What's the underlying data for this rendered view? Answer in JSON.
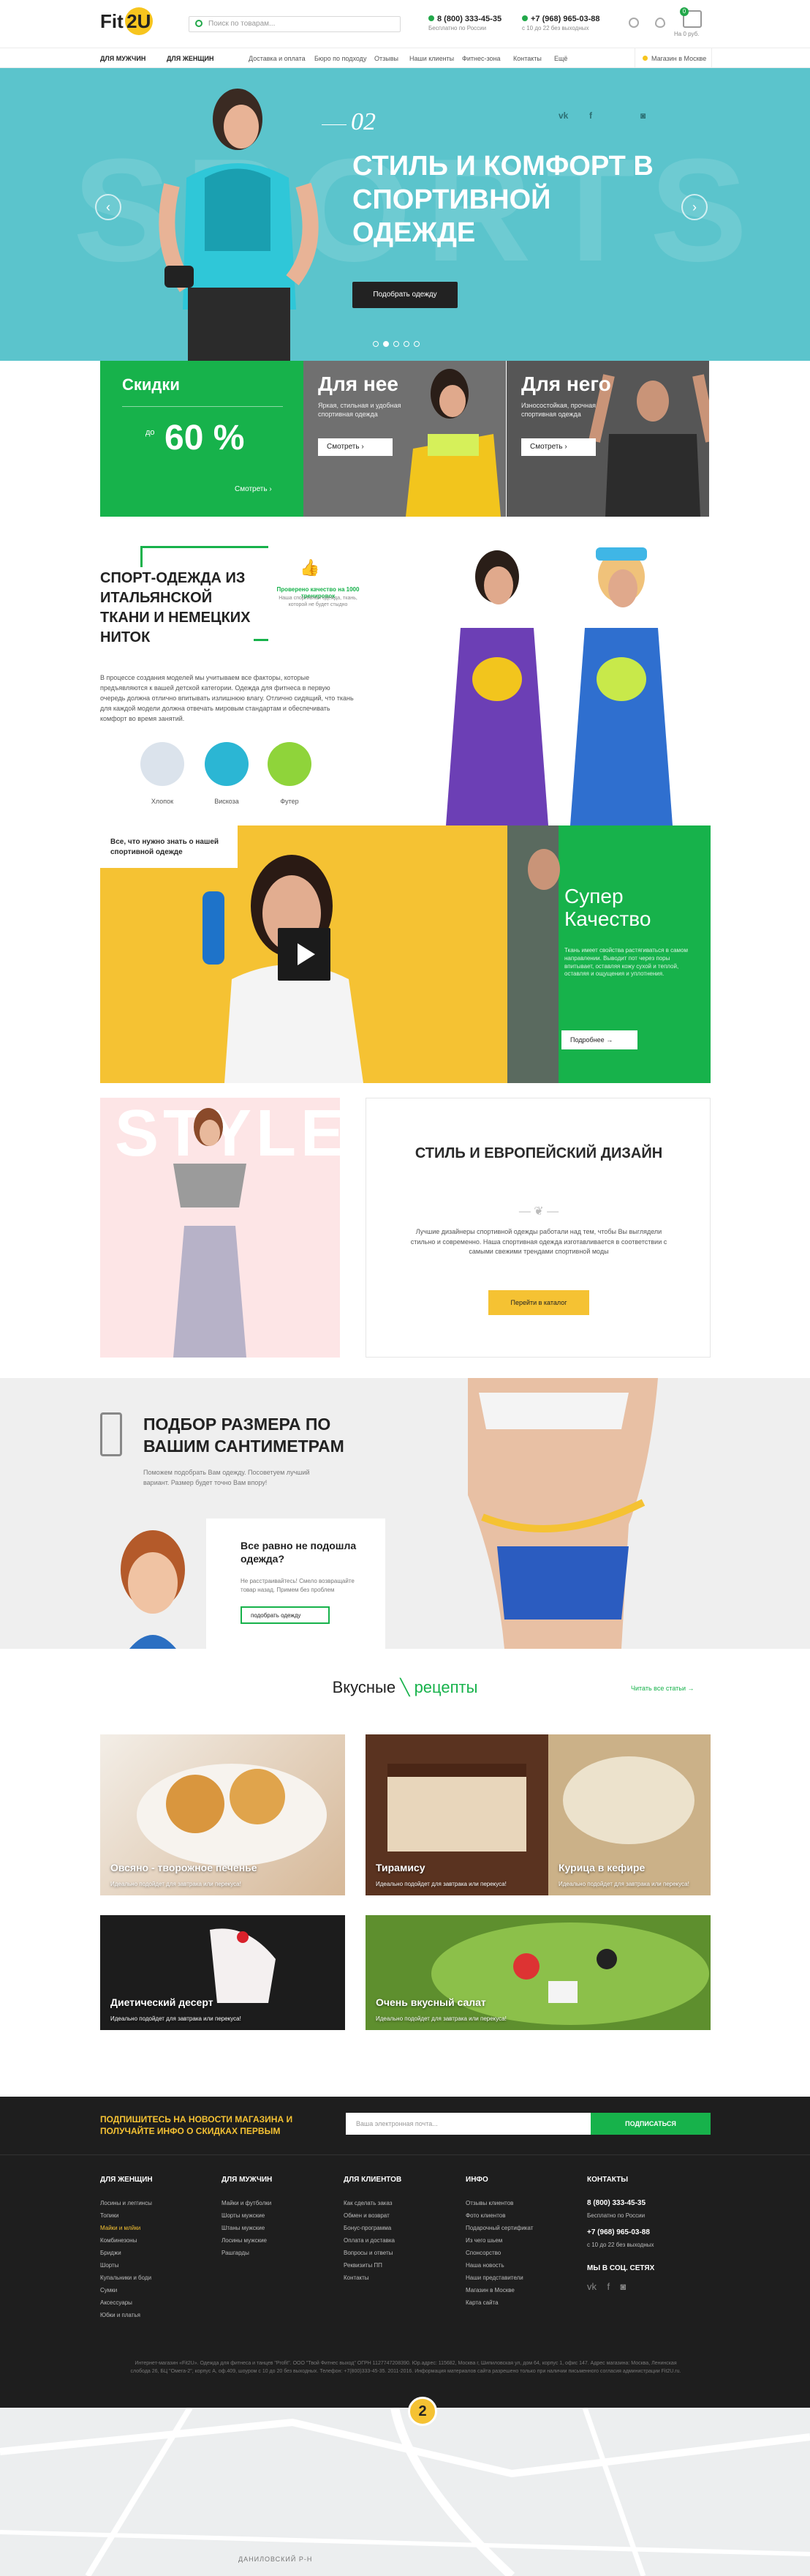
{
  "header": {
    "logo_text": "Fit",
    "logo_accent": "2U",
    "search_placeholder": "Поиск по товарам...",
    "phone1": "8 (800) 333-45-35",
    "phone1_note": "Бесплатно по России",
    "phone2": "+7 (968) 965-03-88",
    "phone2_note": "с 10 до 22 без выходных",
    "cart_count": "0",
    "cart_label": "На 0 руб."
  },
  "nav": {
    "items": [
      "ДЛЯ МУЖЧИН",
      "ДЛЯ ЖЕНЩИН",
      "Доставка и оплата",
      "Бюро по подходу",
      "Отзывы",
      "Наши клиенты",
      "Фитнес-зона",
      "Контакты",
      "Ещё"
    ],
    "city": "Магазин в Москве"
  },
  "hero": {
    "bg_word": "SPORTS",
    "slide_num": "02",
    "title": "СТИЛЬ И КОМФОРТ В СПОРТИВНОЙ ОДЕЖДЕ",
    "button": "Подобрать одежду",
    "social": [
      "vk",
      "f",
      "ig"
    ],
    "active_dot": 1,
    "dots": 5
  },
  "promo": {
    "sale_title": "Скидки",
    "sale_prefix": "до",
    "sale_value": "60 %",
    "sale_more": "Смотреть",
    "her_title": "Для нее",
    "her_text": "Яркая, стильная и удобная спортивная одежда",
    "her_btn": "Смотреть",
    "him_title": "Для него",
    "him_text": "Износостойкая, прочная спортивная одежда",
    "him_btn": "Смотреть"
  },
  "fabric": {
    "title": "СПОРТ-ОДЕЖДА ИЗ ИТАЛЬЯНСКОЙ ТКАНИ И НЕМЕЦКИХ НИТОК",
    "badge_label": "Проверено качество на 1000 тренировок",
    "badge_sub": "Наша спортивная одежда, ткань, которой не будет стыдно",
    "text": "В процессе создания моделей мы учитываем все факторы, которые предъявляются к вашей детской категории. Одежда для фитнеса в первую очередь должна отлично впитывать излишнюю влагу. Отлично сидящий, что ткань для каждой модели должна отвечать мировым стандартам и обеспечивать комфорт во время занятий.",
    "materials": [
      {
        "name": "Хлопок",
        "color": "#dbe3ec"
      },
      {
        "name": "Вискоза",
        "color": "#2bb6d4"
      },
      {
        "name": "Футер",
        "color": "#8fd43a"
      }
    ]
  },
  "video": {
    "note": "Все, что нужно знать о нашей спортивной одежде",
    "title": "Супер Качество",
    "text": "Ткань имеет свойства растягиваться в самом направлении. Выводит пот через поры впитывает, оставляя кожу сухой и теплой, оставляя и ощущения и уплотнения.",
    "button": "Подробнее"
  },
  "style": {
    "bg_word": "STYLE",
    "title": "СТИЛЬ И ЕВРОПЕЙСКИЙ ДИЗАЙН",
    "text": "Лучшие дизайнеры спортивной одежды работали над тем, чтобы Вы выглядели стильно и современно. Наша спортивная одежда изготавливается в соответствии с самыми свежими трендами спортивной моды",
    "button": "Перейти в каталог"
  },
  "size": {
    "title": "ПОДБОР РАЗМЕРА ПО ВАШИМ САНТИМЕТРАМ",
    "sub": "Поможем подобрать Вам одежду. Посоветуем лучший вариант. Размер будет точно Вам впору!",
    "card_title": "Все равно не подошла одежда?",
    "card_text": "Не расстраивайтесь! Смело возвращайте товар назад. Примем без проблем",
    "card_btn": "подобрать одежду"
  },
  "recipes": {
    "title_a": "Вкусные",
    "title_b": "рецепты",
    "all": "Читать все статьи",
    "items": [
      {
        "title": "Овсяно - творожное печенье",
        "desc": "Идеально подойдет для завтрака или перекуса!"
      },
      {
        "title": "Тирамису",
        "desc": "Идеально подойдет для завтрака или перекуса!"
      },
      {
        "title": "Курица в кефире",
        "desc": "Идеально подойдет для завтрака или перекуса!"
      },
      {
        "title": "Диетический десерт",
        "desc": "Идеально подойдет для завтрака или перекуса!"
      },
      {
        "title": "Очень вкусный салат",
        "desc": "Идеально подойдет для завтрака или перекуса!"
      }
    ]
  },
  "footer": {
    "sub_title": "ПОДПИШИТЕСЬ НА НОВОСТИ МАГАЗИНА И ПОЛУЧАЙТЕ ИНФО О СКИДКАХ ПЕРВЫМ",
    "sub_placeholder": "Ваша электронная почта...",
    "sub_btn": "ПОДПИСАТЬСЯ",
    "col1_title": "ДЛЯ ЖЕНЩИН",
    "col1": [
      "Лосины и леггинсы",
      "Топики",
      "Майки и млйки",
      "Комбинезоны",
      "Бриджи",
      "Шорты",
      "Купальники и боди",
      "Сумки",
      "Аксессуары",
      "Юбки и платья"
    ],
    "col2_title": "ДЛЯ МУЖЧИН",
    "col2": [
      "Майки и футболки",
      "Шорты мужские",
      "Штаны мужские",
      "Лосины мужские",
      "Рашгарды"
    ],
    "col3_title": "ДЛЯ КЛИЕНТОВ",
    "col3": [
      "Как сделать заказ",
      "Обмен и возврат",
      "Бонус-программа",
      "Оплата и доставка",
      "Вопросы и ответы",
      "Реквизиты ПП",
      "Контакты"
    ],
    "col4_title": "ИНФО",
    "col4": [
      "Отзывы клиентов",
      "Фото клиентов",
      "Подарочный сертификат",
      "Из чего шьем",
      "Спонсорство",
      "Наша новость",
      "Наши представители",
      "Магазин в Москве",
      "Карта сайта"
    ],
    "col5_title": "КОНТАКТЫ",
    "contact1": "8 (800) 333-45-35",
    "contact1_note": "Бесплатно по России",
    "contact2": "+7 (968) 965-03-88",
    "contact2_note": "с 10 до 22 без выходных",
    "social_title": "МЫ В СОЦ. СЕТЯХ",
    "social": [
      "vk",
      "f",
      "ig"
    ],
    "copyright": "Интернет-магазин «Fit2U». Одежда для фитнеса и танцев \"Profit\". ООО \"Твой Фитнес выход\" ОГРН 1127747208390. Юр.адрес: 115682, Москва г, Шипиловская ул, дом 64, корпус 1, офис 147. Адрес магазина: Москва, Ленинская слобода 26, БЦ \"Омега-2\", корпус А, оф.409, шоурoм с 10 до 20 без выходных. Телефон: +7(800)333-45-35. 2011-2016. Информация материалов сайта разрешено только при наличии письменного согласия администрации Fit2U.ru.",
    "map_label": "ДАНИЛОВСКИЙ Р-Н",
    "map_pin": "2"
  },
  "colors": {
    "green": "#17b24b",
    "yellow": "#f5c233",
    "teal": "#5bc4cc",
    "dark": "#1e1e1e"
  }
}
